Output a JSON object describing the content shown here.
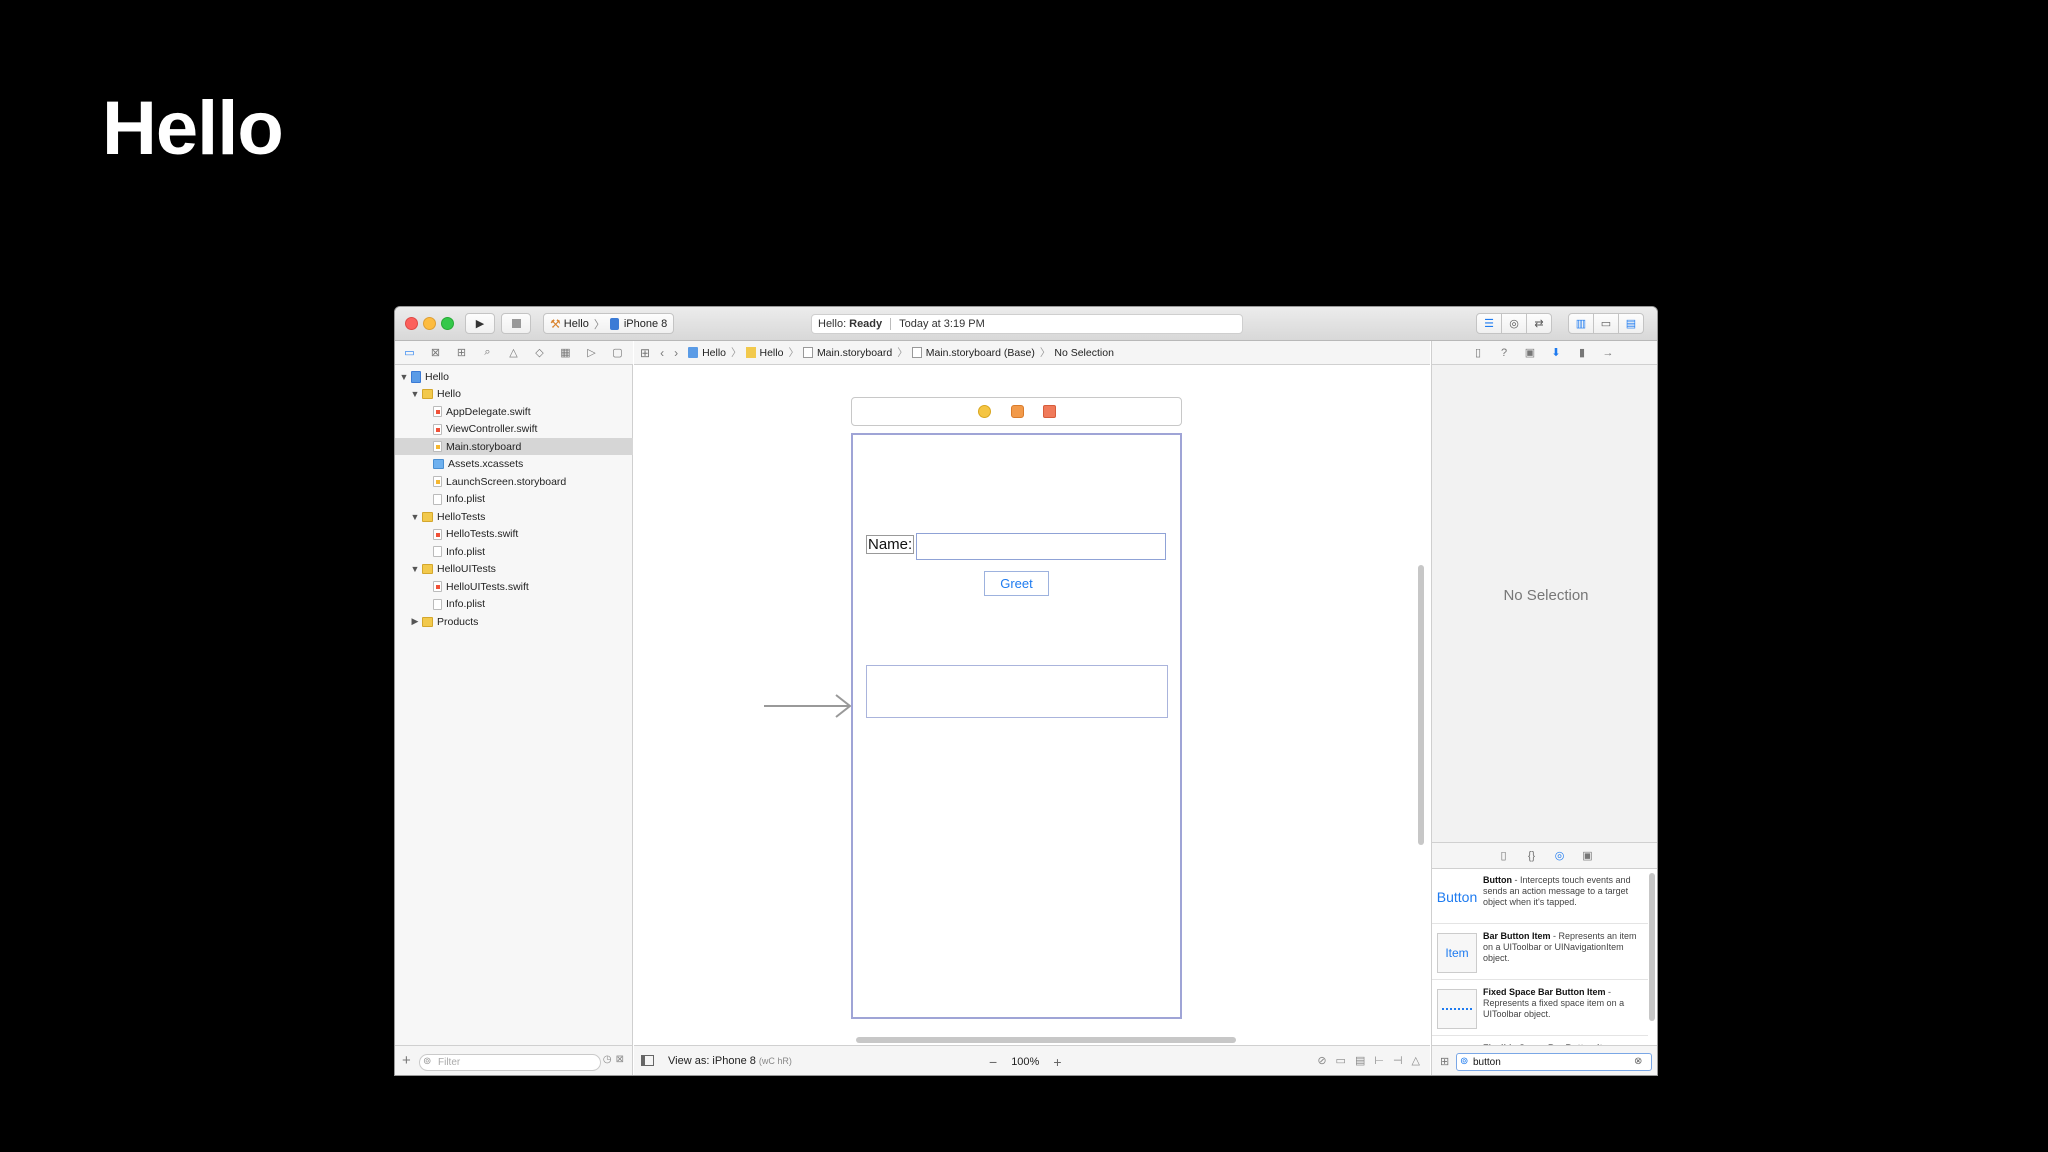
{
  "slide": {
    "title": "Hello"
  },
  "toolbar": {
    "scheme_project": "Hello",
    "scheme_device": "iPhone 8",
    "status_project": "Hello:",
    "status_state": "Ready",
    "status_time": "Today at 3:19 PM"
  },
  "navigator": {
    "items": [
      {
        "label": "Hello",
        "indent": 0,
        "disclosure": "open",
        "icon": "project-icon",
        "selected": false
      },
      {
        "label": "Hello",
        "indent": 1,
        "disclosure": "open",
        "icon": "folder-icon",
        "selected": false
      },
      {
        "label": "AppDelegate.swift",
        "indent": 2,
        "disclosure": "",
        "icon": "swift-file-icon",
        "selected": false
      },
      {
        "label": "ViewController.swift",
        "indent": 2,
        "disclosure": "",
        "icon": "swift-file-icon",
        "selected": false
      },
      {
        "label": "Main.storyboard",
        "indent": 2,
        "disclosure": "",
        "icon": "storyboard-file-icon",
        "selected": true
      },
      {
        "label": "Assets.xcassets",
        "indent": 2,
        "disclosure": "",
        "icon": "asset-folder-icon",
        "selected": false
      },
      {
        "label": "LaunchScreen.storyboard",
        "indent": 2,
        "disclosure": "",
        "icon": "storyboard-file-icon",
        "selected": false
      },
      {
        "label": "Info.plist",
        "indent": 2,
        "disclosure": "",
        "icon": "plist-file-icon",
        "selected": false
      },
      {
        "label": "HelloTests",
        "indent": 1,
        "disclosure": "open",
        "icon": "folder-icon",
        "selected": false
      },
      {
        "label": "HelloTests.swift",
        "indent": 2,
        "disclosure": "",
        "icon": "swift-file-icon",
        "selected": false
      },
      {
        "label": "Info.plist",
        "indent": 2,
        "disclosure": "",
        "icon": "plist-file-icon",
        "selected": false
      },
      {
        "label": "HelloUITests",
        "indent": 1,
        "disclosure": "open",
        "icon": "folder-icon",
        "selected": false
      },
      {
        "label": "HelloUITests.swift",
        "indent": 2,
        "disclosure": "",
        "icon": "swift-file-icon",
        "selected": false
      },
      {
        "label": "Info.plist",
        "indent": 2,
        "disclosure": "",
        "icon": "plist-file-icon",
        "selected": false
      },
      {
        "label": "Products",
        "indent": 1,
        "disclosure": "closed",
        "icon": "folder-icon",
        "selected": false
      }
    ],
    "filter_placeholder": "Filter"
  },
  "jumpbar": {
    "crumbs": [
      "Hello",
      "Hello",
      "Main.storyboard",
      "Main.storyboard (Base)",
      "No Selection"
    ]
  },
  "canvas": {
    "name_label": "Name:",
    "greet_button": "Greet"
  },
  "editor_footer": {
    "view_as": "View as: iPhone 8",
    "view_as_hint": "(wC hR)",
    "zoom_level": "100%"
  },
  "inspector": {
    "empty_text": "No Selection"
  },
  "library": {
    "items": [
      {
        "thumb": "Button",
        "title": "Button",
        "desc": " - Intercepts touch events and sends an action message to a target object when it's tapped."
      },
      {
        "thumb": "Item",
        "title": "Bar Button Item",
        "desc": " - Represents an item on a UIToolbar or UINavigationItem object."
      },
      {
        "thumb": "",
        "title": "Fixed Space Bar Button Item",
        "desc": " - Represents a fixed space item on a UIToolbar object."
      },
      {
        "thumb": "",
        "title": "Flexible Space Bar Button Item",
        "desc": ""
      }
    ],
    "search_value": "button"
  }
}
